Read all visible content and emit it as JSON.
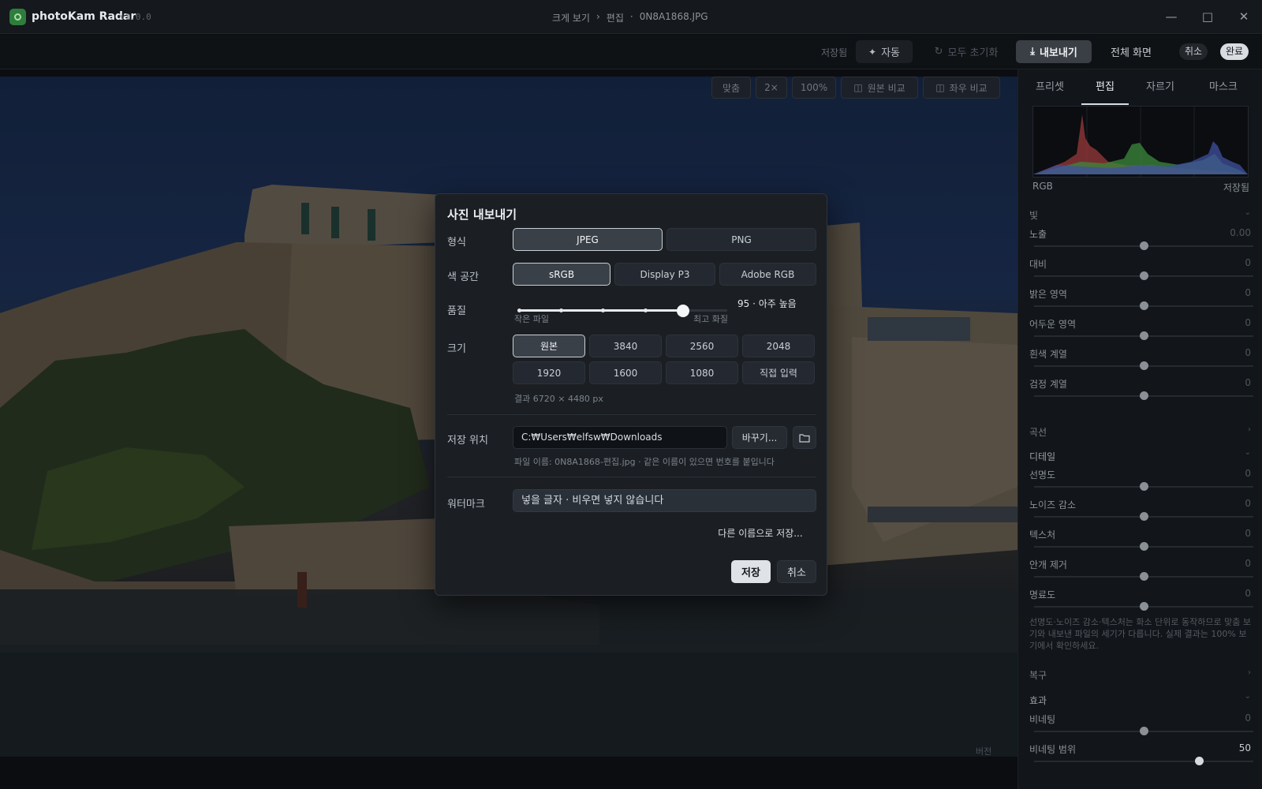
{
  "titlebar": {
    "app_name": "photoKam Radar",
    "version": "v1.0.0",
    "breadcrumb": [
      "크게 보기",
      "›",
      "편집",
      "·",
      "0N8A1868.JPG"
    ]
  },
  "toolbar": {
    "saved_status": "저장됨",
    "auto_label": "자동",
    "reset_all_label": "모두 초기화",
    "export_label": "내보내기",
    "fullscreen_label": "전체 화면",
    "cancel_label": "취소",
    "done_label": "완료"
  },
  "view_tools": {
    "fit": "맞춤",
    "zoom2": "2×",
    "zoom100": "100%",
    "compare_original": "원본 비교",
    "compare_side": "좌우 비교"
  },
  "canvas": {
    "bottom_label": "버전"
  },
  "panel": {
    "tabs": [
      "프리셋",
      "편집",
      "자르기",
      "마스크"
    ],
    "active_tab": 1,
    "histogram": {
      "channel": "RGB",
      "status": "저장됨"
    },
    "section_light": "빛",
    "light_sliders": [
      {
        "label": "노출",
        "value": "0.00",
        "level": 0.5
      },
      {
        "label": "대비",
        "value": "0",
        "level": 0.5
      },
      {
        "label": "밝은 영역",
        "value": "0",
        "level": 0.5
      },
      {
        "label": "어두운 영역",
        "value": "0",
        "level": 0.5
      },
      {
        "label": "흰색 계열",
        "value": "0",
        "level": 0.5
      },
      {
        "label": "검정 계열",
        "value": "0",
        "level": 0.5
      }
    ],
    "section_curve": "곡선",
    "section_detail": "디테일",
    "detail_sliders": [
      {
        "label": "선명도",
        "value": "0",
        "level": 0.5
      },
      {
        "label": "노이즈 감소",
        "value": "0",
        "level": 0.5
      },
      {
        "label": "텍스처",
        "value": "0",
        "level": 0.5
      },
      {
        "label": "안개 제거",
        "value": "0",
        "level": 0.5
      },
      {
        "label": "명료도",
        "value": "0",
        "level": 0.5
      }
    ],
    "detail_note": "선명도·노이즈 감소·텍스처는 화소 단위로 동작하므로 맞춤 보기와 내보낸 파일의 세기가 다릅니다. 실제 결과는 100% 보기에서 확인하세요.",
    "section_restore": "복구",
    "section_effects": "효과",
    "effect_sliders": [
      {
        "label": "비네팅",
        "value": "0",
        "level": 0.5
      },
      {
        "label": "비네팅 범위",
        "value": "50",
        "level": 0.75
      }
    ]
  },
  "dialog": {
    "title": "사진 내보내기",
    "format_label": "형식",
    "formats": [
      "JPEG",
      "PNG"
    ],
    "colorspace_label": "색 공간",
    "colorspaces": [
      "sRGB",
      "Display P3",
      "Adobe RGB"
    ],
    "quality_label": "품질",
    "quality_value": 95,
    "quality_text": "95 · 아주 높음",
    "quality_min_label": "작은 파일",
    "quality_max_label": "최고 화질",
    "size_label": "크기",
    "sizes": [
      "원본",
      "3840",
      "2560",
      "2048",
      "1920",
      "1600",
      "1080",
      "직접 입력"
    ],
    "result_text": "결과 6720 × 4480 px",
    "location_label": "저장 위치",
    "location_path": "C:₩Users₩elfsw₩Downloads",
    "change_label": "바꾸기...",
    "filename_note": "파일 이름: 0N8A1868-편집.jpg · 같은 이름이 있으면 번호를 붙입니다",
    "watermark_label": "워터마크",
    "watermark_placeholder": "넣을 글자 · 비우면 넣지 않습니다",
    "save_as_label": "다른 이름으로 저장...",
    "save_label": "저장",
    "cancel_label": "취소"
  },
  "colors": {
    "accent": "#e7eaee",
    "panel_bg": "#121519",
    "dialog_bg": "#1b1f24"
  }
}
